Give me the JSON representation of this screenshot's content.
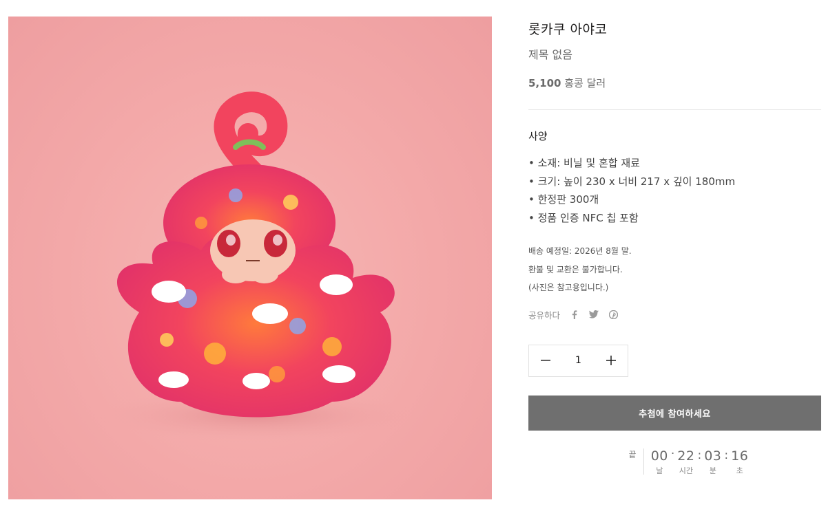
{
  "product": {
    "vendor": "롯카쿠 아야코",
    "title": "제목 없음",
    "price_amount": "5,100",
    "price_currency": "홍콩 달러",
    "image_icon": "toy-figure-image"
  },
  "specs": {
    "heading": "사양",
    "items": [
      "소재: 비닐 및 혼합 재료",
      "크기: 높이 230 x 너비 217 x 깊이 180mm",
      "한정판 300개",
      "정품 인증 NFC 칩 포함"
    ]
  },
  "notes": [
    "배송 예정일: 2026년 8월 말.",
    "환불 및 교환은 불가합니다.",
    "(사진은 참고용입니다.)"
  ],
  "share": {
    "label": "공유하다",
    "icons": [
      "facebook-icon",
      "twitter-icon",
      "pinterest-icon"
    ]
  },
  "quantity": {
    "value": "1",
    "decrement_icon": "minus-icon",
    "increment_icon": "plus-icon"
  },
  "cta": {
    "label": "추첨에 참여하세요",
    "background": "#6f6f6f"
  },
  "countdown": {
    "end_label": "끝",
    "units": [
      {
        "value": "00",
        "label": "날"
      },
      {
        "value": "22",
        "label": "시간"
      },
      {
        "value": "03",
        "label": "분"
      },
      {
        "value": "16",
        "label": "초"
      }
    ],
    "separators": [
      "·",
      ":",
      ":"
    ]
  },
  "colors": {
    "image_background": "#f3a8a8",
    "text_primary": "#1c1b1b",
    "text_muted": "#6a6a6a",
    "divider": "#e6e6e6"
  }
}
